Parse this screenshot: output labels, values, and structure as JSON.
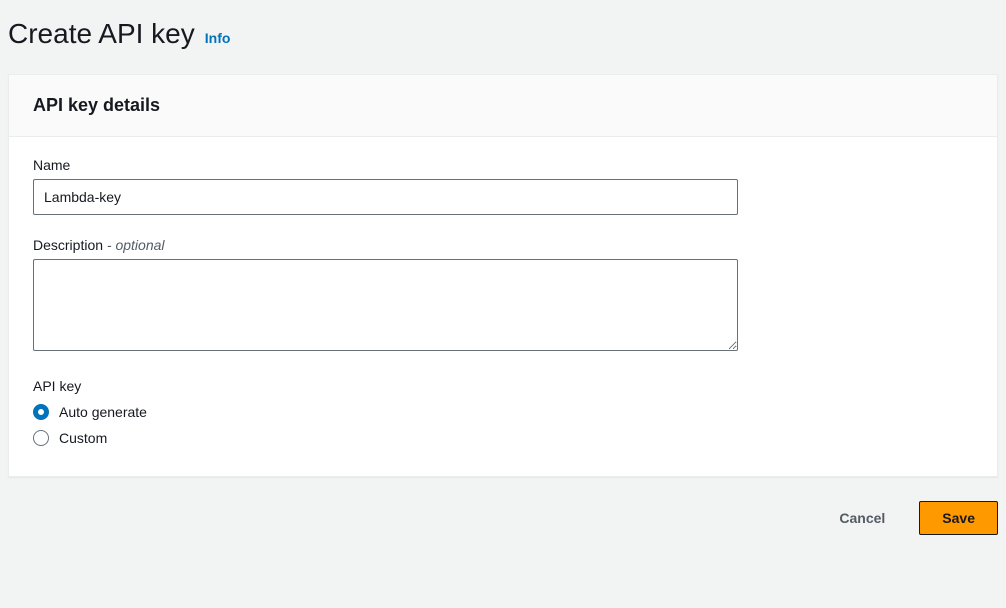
{
  "header": {
    "title": "Create API key",
    "info_label": "Info"
  },
  "panel": {
    "title": "API key details",
    "name": {
      "label": "Name",
      "value": "Lambda-key"
    },
    "description": {
      "label": "Description",
      "optional_suffix": " - optional",
      "value": ""
    },
    "api_key_section": {
      "label": "API key",
      "options": [
        {
          "label": "Auto generate",
          "selected": true
        },
        {
          "label": "Custom",
          "selected": false
        }
      ]
    }
  },
  "buttons": {
    "cancel": "Cancel",
    "save": "Save"
  }
}
